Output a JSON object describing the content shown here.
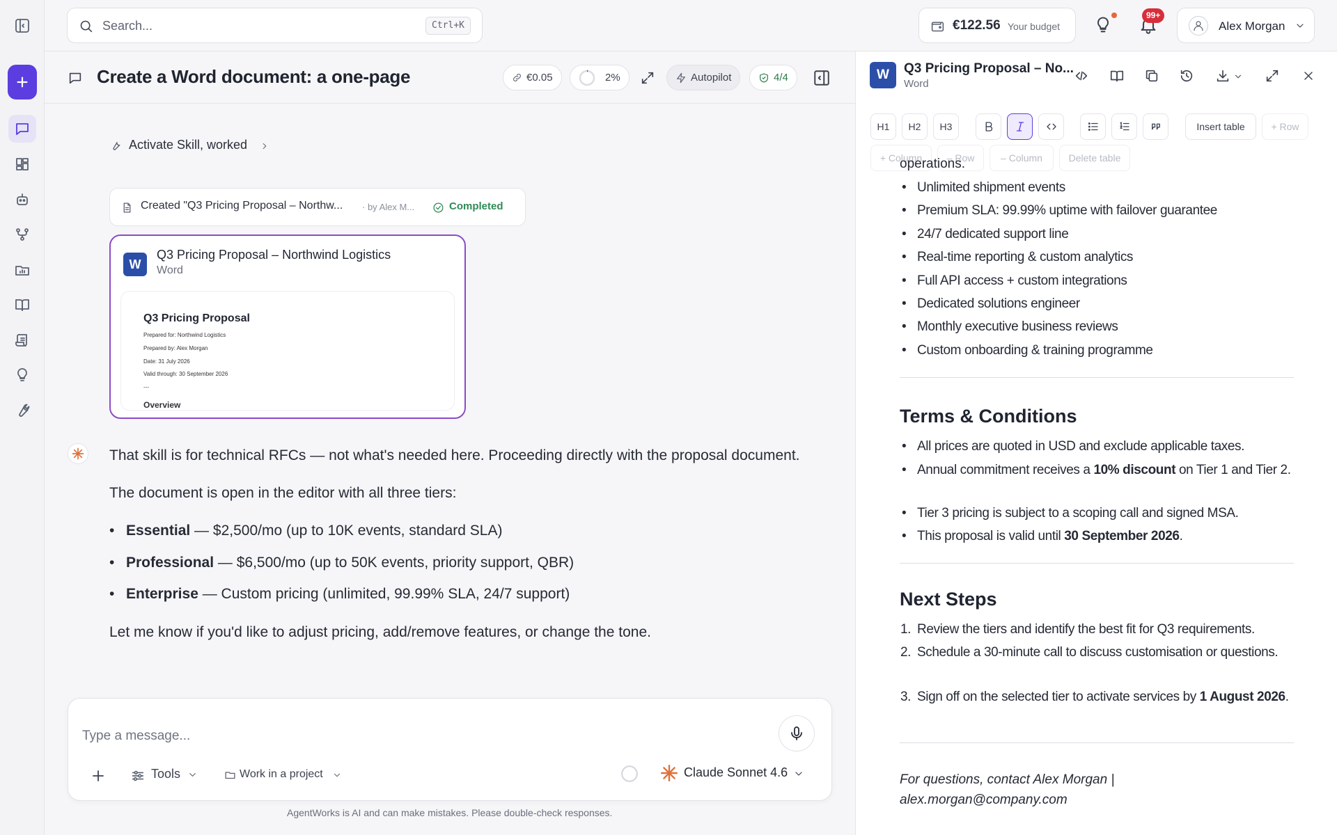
{
  "search": {
    "placeholder": "Search...",
    "shortcut": "Ctrl+K"
  },
  "budget": {
    "amount": "€122.56",
    "label": "Your budget"
  },
  "notifications": {
    "badge": "99+"
  },
  "user": {
    "name": "Alex Morgan"
  },
  "chat": {
    "title": "Create a Word document: a one-page",
    "cost": "€0.05",
    "progress": "2%",
    "mode": "Autopilot",
    "steps": "4/4"
  },
  "activity": {
    "skill_label": "Activate Skill, worked",
    "created_text": "Created \"Q3 Pricing Proposal – Northw...",
    "created_by": "· by Alex M...",
    "status": "Completed"
  },
  "doc_card": {
    "title": "Q3 Pricing Proposal – Northwind Logistics",
    "type": "Word",
    "preview": {
      "title": "Q3 Pricing Proposal",
      "lines": [
        "Prepared for: Northwind Logistics",
        "Prepared by: Alex Morgan",
        "Date: 31 July 2026",
        "Valid through: 30 September 2026",
        "---"
      ],
      "section": "Overview"
    }
  },
  "message": {
    "intro": "That skill is for technical RFCs — not what's needed here. Proceeding directly with the proposal document.",
    "lead": "The document is open in the editor with all three tiers:",
    "tiers": [
      {
        "name": "Essential",
        "desc": " — $2,500/mo (up to 10K events, standard SLA)"
      },
      {
        "name": "Professional",
        "desc": " — $6,500/mo (up to 50K events, priority support, QBR)"
      },
      {
        "name": "Enterprise",
        "desc": " — Custom pricing (unlimited, 99.99% SLA, 24/7 support)"
      }
    ],
    "outro": "Let me know if you'd like to adjust pricing, add/remove features, or change the tone."
  },
  "composer": {
    "placeholder": "Type a message...",
    "tools": "Tools",
    "project": "Work in a project",
    "model": "Claude Sonnet 4.6",
    "disclaimer": "AgentWorks is AI and can make mistakes. Please double-check responses."
  },
  "editor": {
    "title": "Q3 Pricing Proposal – No...",
    "type": "Word",
    "toolbar": {
      "h1": "H1",
      "h2": "H2",
      "h3": "H3",
      "insert_table": "Insert table",
      "add_row": "+ Row",
      "add_column": "+ Column",
      "del_row": "– Row",
      "del_column": "– Column",
      "delete_table": "Delete table"
    },
    "ops_tail": "operations.",
    "features": [
      "Unlimited shipment events",
      "Premium SLA: 99.99% uptime with failover guarantee",
      "24/7 dedicated support line",
      "Real-time reporting & custom analytics",
      "Full API access + custom integrations",
      "Dedicated solutions engineer",
      "Monthly executive business reviews",
      "Custom onboarding & training programme"
    ],
    "terms_heading": "Terms & Conditions",
    "terms": {
      "t1": "All prices are quoted in USD and exclude applicable taxes.",
      "t2_a": "Annual commitment receives a ",
      "t2_b": "10% discount",
      "t2_c": " on Tier 1 and Tier 2.",
      "t3": "Tier 3 pricing is subject to a scoping call and signed MSA.",
      "t4_a": "This proposal is valid until ",
      "t4_b": "30 September 2026",
      "t4_c": "."
    },
    "next_heading": "Next Steps",
    "next": {
      "n1": "Review the tiers and identify the best fit for Q3 requirements.",
      "n2": "Schedule a 30-minute call to discuss customisation or questions.",
      "n3_a": "Sign off on the selected tier to activate services by ",
      "n3_b": "1 August 2026",
      "n3_c": "."
    },
    "contact": "For questions, contact Alex Morgan | alex.morgan@company.com"
  },
  "colors": {
    "accent": "#5b3de0",
    "word_blue": "#2b4fa8",
    "success": "#2f8a56",
    "badge_red": "#d92d3a"
  }
}
